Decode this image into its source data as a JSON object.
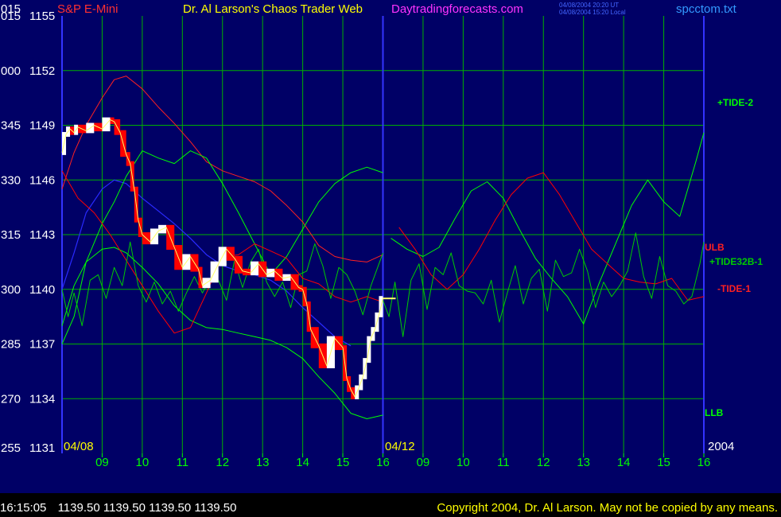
{
  "header": {
    "left_code": "015",
    "symbol": "S&P E-Mini",
    "title": "Dr. Al Larson's Chaos Trader Web",
    "website": "Daytradingforecasts.com",
    "stamp_line1": "04/08/2004 20:20 UT",
    "stamp_line2": "04/08/2004 15:20 Local",
    "filename": "spcctom.txt"
  },
  "footer": {
    "time": "16:15:05",
    "ohlc": "1139.50 1139.50 1139.50 1139.50",
    "copyright": "Copyright 2004, Dr. Al Larson. May not be copied by any means."
  },
  "colors": {
    "background": "#000066",
    "grid": "#00b000",
    "price_axis": "#ffffff",
    "left_codes": "#ffffff",
    "date_labels": "#ffff00",
    "x_ticks": "#00ff00",
    "tide2": "#00ff00",
    "tide32b": "#00cc00",
    "tide1": "#ff0000",
    "ulb": "#ff2020",
    "llb": "#00ff00",
    "price_up": "#ffffff",
    "price_down": "#ff0000",
    "average": "#ffff66",
    "divider": "#3333ff"
  },
  "chart_data": {
    "type": "line",
    "title": "S&P E-Mini",
    "ylim": [
      1131,
      1155
    ],
    "y_ticks": [
      {
        "code": "015",
        "value": 1155
      },
      {
        "code": "000",
        "value": 1152
      },
      {
        "code": "345",
        "value": 1149
      },
      {
        "code": "330",
        "value": 1146
      },
      {
        "code": "315",
        "value": 1143
      },
      {
        "code": "300",
        "value": 1140
      },
      {
        "code": "285",
        "value": 1137
      },
      {
        "code": "270",
        "value": 1134
      },
      {
        "code": "255",
        "value": 1131
      }
    ],
    "xlim": [
      8.0,
      16.0
    ],
    "x_ticks": [
      "09",
      "10",
      "11",
      "12",
      "13",
      "14",
      "15",
      "16",
      "09",
      "10",
      "11",
      "12",
      "13",
      "14",
      "15",
      "16"
    ],
    "x_tick_positions": [
      9,
      10,
      11,
      12,
      13,
      14,
      15,
      16,
      9,
      10,
      11,
      12,
      13,
      14,
      15,
      16
    ],
    "date_labels": {
      "start": "04/08",
      "mid": "04/12",
      "end": "2004"
    },
    "series_labels": {
      "tide2": "+TIDE-2",
      "ulb": "ULB",
      "tide32b": "+TIDE32B-1",
      "tide1": "-TIDE-1",
      "llb": "LLB"
    },
    "series": [
      {
        "name": "price",
        "day": "04/08",
        "x": [
          8.0,
          8.1,
          8.2,
          8.3,
          8.4,
          8.6,
          8.8,
          9.0,
          9.2,
          9.3,
          9.45,
          9.6,
          9.7,
          9.8,
          9.9,
          10.0,
          10.2,
          10.4,
          10.6,
          10.8,
          11.0,
          11.2,
          11.4,
          11.5,
          11.7,
          11.9,
          12.1,
          12.3,
          12.5,
          12.7,
          12.9,
          13.1,
          13.3,
          13.5,
          13.7,
          13.9,
          14.0,
          14.1,
          14.2,
          14.4,
          14.6,
          14.8,
          15.0,
          15.1,
          15.2,
          15.3,
          15.4,
          15.5,
          15.6,
          15.7,
          15.8,
          15.9,
          16.0
        ],
        "values": [
          1147.5,
          1148.5,
          1148.8,
          1148.6,
          1148.9,
          1148.7,
          1149.0,
          1148.8,
          1149.3,
          1149.2,
          1148.6,
          1147.4,
          1146.9,
          1145.5,
          1143.8,
          1143.0,
          1142.6,
          1143.2,
          1143.4,
          1142.3,
          1141.2,
          1141.8,
          1141.1,
          1140.2,
          1140.5,
          1141.4,
          1142.2,
          1141.7,
          1141.0,
          1140.9,
          1141.4,
          1140.8,
          1141.0,
          1140.6,
          1140.7,
          1140.1,
          1140.0,
          1139.2,
          1137.8,
          1136.9,
          1135.8,
          1137.3,
          1136.8,
          1135.1,
          1134.5,
          1134.1,
          1134.6,
          1135.2,
          1136.1,
          1137.3,
          1137.8,
          1138.6,
          1139.5
        ]
      },
      {
        "name": "ULB",
        "x": [
          8.0,
          8.3,
          8.6,
          9.0,
          9.3,
          9.6,
          10.0,
          10.4,
          10.8,
          11.2,
          11.6,
          12.0,
          12.4,
          12.8,
          13.2,
          13.6,
          14.0,
          14.4,
          14.8,
          15.2,
          15.6,
          16.0
        ],
        "values": [
          1145.5,
          1147.5,
          1149.0,
          1150.5,
          1151.5,
          1151.7,
          1151.0,
          1150.0,
          1149.1,
          1148.1,
          1147.0,
          1146.5,
          1146.2,
          1145.9,
          1145.4,
          1144.6,
          1143.7,
          1142.4,
          1141.8,
          1141.6,
          1141.5,
          1141.9
        ]
      },
      {
        "name": "LLB",
        "x": [
          8.0,
          8.3,
          8.6,
          9.0,
          9.3,
          9.6,
          10.0,
          10.4,
          10.8,
          11.2,
          11.6,
          12.0,
          12.4,
          12.8,
          13.2,
          13.6,
          14.0,
          14.4,
          14.8,
          15.2,
          15.6,
          16.0
        ],
        "values": [
          1138.0,
          1140.2,
          1141.5,
          1142.2,
          1142.3,
          1142.0,
          1141.2,
          1140.3,
          1139.1,
          1138.3,
          1137.9,
          1137.8,
          1137.6,
          1137.4,
          1137.2,
          1136.8,
          1136.2,
          1135.2,
          1134.3,
          1133.2,
          1132.9,
          1133.1
        ]
      },
      {
        "name": "blue_average",
        "x": [
          8.0,
          8.3,
          8.6,
          9.0,
          9.3,
          9.6,
          10.0,
          10.4,
          10.8,
          11.2,
          11.6,
          12.0,
          12.4,
          12.8,
          13.2,
          13.6,
          14.0,
          14.4,
          14.8,
          15.2
        ],
        "values": [
          1140.0,
          1142.0,
          1144.2,
          1145.5,
          1146.0,
          1145.8,
          1145.0,
          1144.3,
          1143.6,
          1142.8,
          1141.9,
          1141.3,
          1141.0,
          1140.8,
          1140.5,
          1139.9,
          1139.0,
          1138.2,
          1137.4,
          1136.9
        ]
      },
      {
        "name": "+TIDE-2",
        "x": [
          8.0,
          8.3,
          8.6,
          9.0,
          9.3,
          9.6,
          10.0,
          10.4,
          10.8,
          11.2,
          11.6,
          12.0,
          12.4,
          12.8,
          13.2,
          13.6,
          14.0,
          14.4,
          14.8,
          15.2,
          15.6,
          16.0,
          8.2,
          8.6,
          9.0,
          9.4,
          9.8,
          10.2,
          10.6,
          11.0,
          11.4,
          11.8,
          12.2,
          12.6,
          13.0,
          13.4,
          13.8,
          14.2,
          14.6,
          15.0,
          15.4,
          15.8,
          16.0
        ],
        "values": [
          1137.0,
          1138.5,
          1141.5,
          1143.6,
          1144.8,
          1146.2,
          1147.6,
          1147.2,
          1146.9,
          1147.6,
          1147.2,
          1145.8,
          1144.2,
          1142.5,
          1140.8,
          1141.8,
          1143.3,
          1144.8,
          1145.8,
          1146.4,
          1146.7,
          1146.4,
          1142.8,
          1142.2,
          1141.8,
          1142.3,
          1143.9,
          1145.4,
          1145.9,
          1145.0,
          1143.3,
          1141.7,
          1140.6,
          1139.6,
          1138.1,
          1140.4,
          1142.5,
          1144.6,
          1146.0,
          1144.8,
          1144.0,
          1147.0,
          1148.6
        ]
      },
      {
        "name": "+TIDE32B-1",
        "x": [
          8.0,
          8.15,
          8.3,
          8.5,
          8.7,
          8.9,
          9.1,
          9.3,
          9.5,
          9.7,
          9.9,
          10.1,
          10.3,
          10.5,
          10.7,
          10.9,
          11.1,
          11.3,
          11.5,
          11.7,
          11.9,
          12.1,
          12.3,
          12.5,
          12.7,
          12.9,
          13.1,
          13.3,
          13.5,
          13.7,
          13.9,
          14.1,
          14.3,
          14.5,
          14.7,
          14.9,
          15.1,
          15.3,
          15.5,
          15.7,
          15.9,
          16.0
        ],
        "values": [
          1140.0,
          1138.5,
          1139.8,
          1138.0,
          1140.5,
          1140.8,
          1139.5,
          1141.2,
          1140.2,
          1142.6,
          1140.2,
          1139.3,
          1140.4,
          1139.2,
          1139.9,
          1138.8,
          1139.8,
          1140.7,
          1139.8,
          1140.6,
          1140.5,
          1139.4,
          1141.6,
          1140.1,
          1141.5,
          1142.2,
          1140.4,
          1139.6,
          1140.4,
          1139.0,
          1140.8,
          1141.0,
          1142.5,
          1141.3,
          1139.5,
          1141.2,
          1140.8,
          1139.9,
          1138.6,
          1140.2,
          1141.4,
          1142.0
        ]
      },
      {
        "name": "-TIDE-1",
        "x": [
          8.0,
          8.4,
          8.8,
          9.2,
          9.6,
          10.0,
          10.4,
          10.8,
          11.2,
          11.6,
          12.0,
          12.4,
          12.8,
          13.2,
          13.6,
          14.0,
          14.4,
          14.8,
          15.2,
          15.6,
          16.0,
          8.4,
          8.8,
          9.2,
          9.6,
          10.0,
          10.4,
          10.8,
          11.2,
          11.6,
          12.0,
          12.4,
          12.8,
          13.2,
          13.6,
          14.0,
          14.4,
          14.8,
          15.2,
          15.6,
          16.0
        ],
        "values": [
          1146.5,
          1145.0,
          1144.2,
          1143.0,
          1141.6,
          1140.2,
          1138.8,
          1137.6,
          1137.9,
          1139.8,
          1141.8,
          1141.9,
          1142.5,
          1142.1,
          1141.7,
          1140.6,
          1140.3,
          1139.6,
          1139.3,
          1139.6,
          1139.3,
          1143.4,
          1142.2,
          1140.8,
          1140.0,
          1140.8,
          1142.2,
          1143.8,
          1145.2,
          1146.1,
          1146.4,
          1145.2,
          1143.7,
          1142.2,
          1141.4,
          1140.6,
          1140.4,
          1140.3,
          1140.6,
          1139.4,
          1139.6
        ]
      }
    ]
  }
}
